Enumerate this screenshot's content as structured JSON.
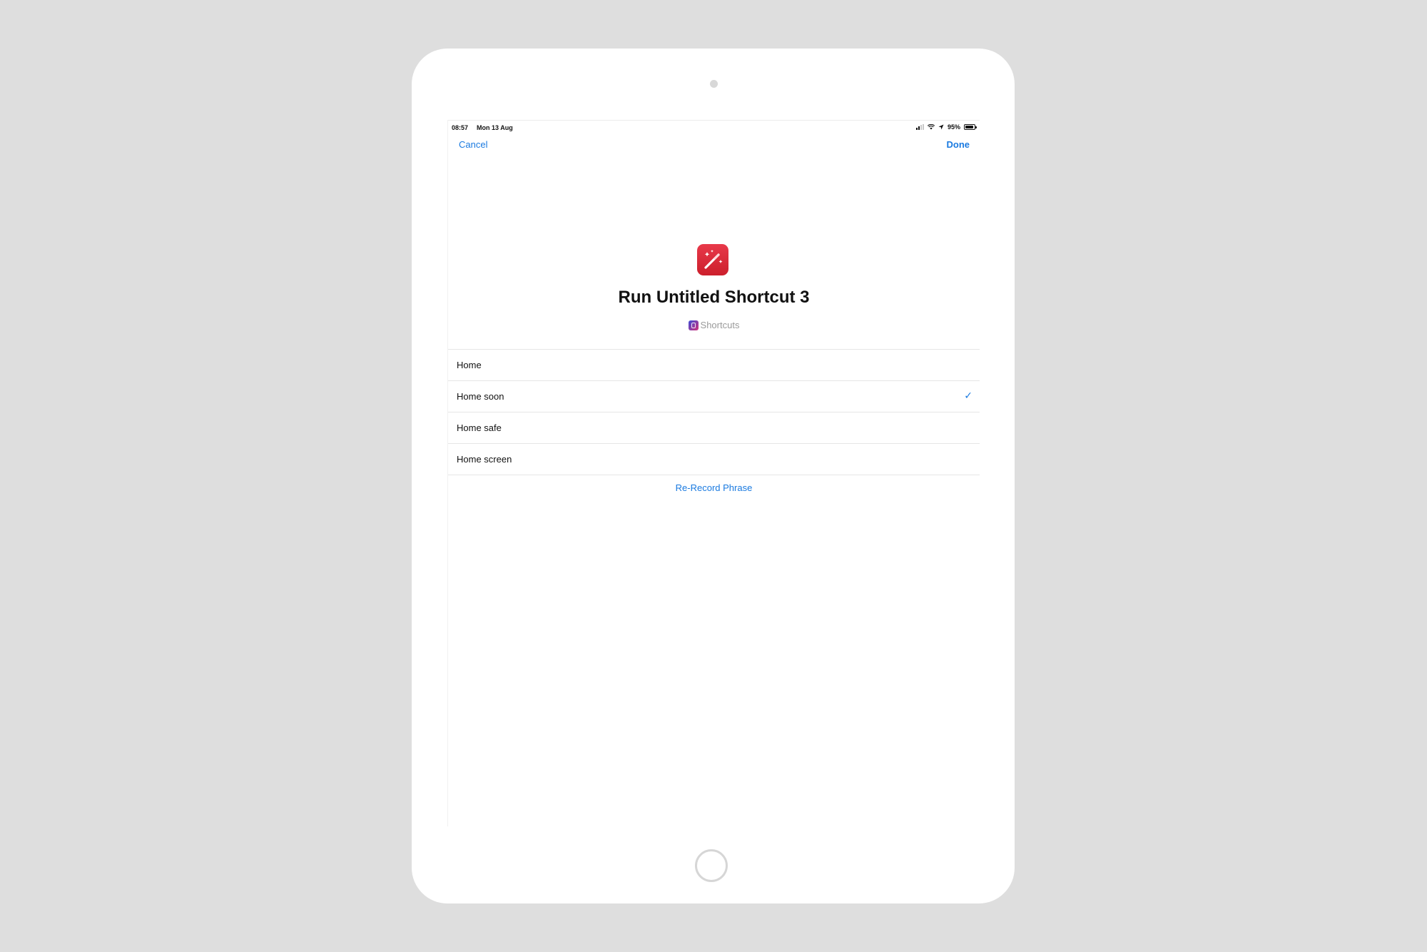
{
  "status_bar": {
    "time": "08:57",
    "date": "Mon 13 Aug",
    "battery": "95%",
    "battery_level": 0.95
  },
  "nav": {
    "cancel_label": "Cancel",
    "done_label": "Done"
  },
  "shortcut": {
    "icon": "magic-wand-icon",
    "icon_color": "#d9262f",
    "title": "Run Untitled Shortcut 3",
    "app_icon": "shortcuts-app-icon",
    "app_name": "Shortcuts"
  },
  "phrases": [
    {
      "label": "Home",
      "selected": false
    },
    {
      "label": "Home soon",
      "selected": true
    },
    {
      "label": "Home safe",
      "selected": false
    },
    {
      "label": "Home screen",
      "selected": false
    }
  ],
  "checkmark": "✓",
  "rerecord_label": "Re-Record Phrase",
  "accent_color": "#1a7ae0"
}
